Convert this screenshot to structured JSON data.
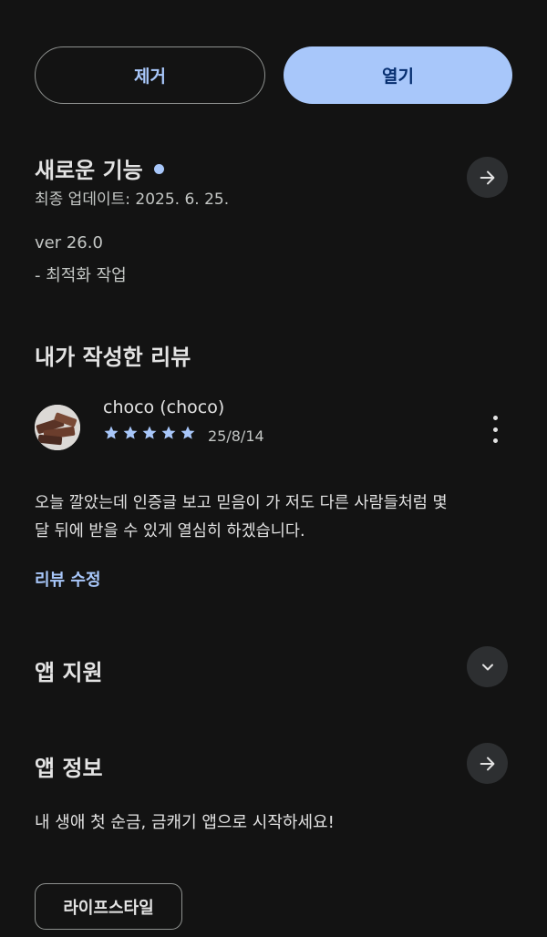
{
  "actions": {
    "uninstall_label": "제거",
    "open_label": "열기"
  },
  "whats_new": {
    "title": "새로운 기능",
    "updated": "최종 업데이트: 2025. 6. 25.",
    "version": "ver 26.0",
    "note": "- 최적화 작업"
  },
  "my_review": {
    "title": "내가 작성한 리뷰",
    "author": "choco (choco)",
    "rating": 5,
    "date": "25/8/14",
    "body_line1": "오늘 깔았는데 인증글 보고 믿음이 가 저도 다른 사람들처럼 몇",
    "body_line2": "달 뒤에 받을 수 있게 열심히 하겠습니다.",
    "edit_label": "리뷰 수정"
  },
  "app_support": {
    "title": "앱 지원"
  },
  "app_info": {
    "title": "앱 정보",
    "description": "내 생애 첫 순금, 금캐기 앱으로 시작하세요!",
    "category": "라이프스타일"
  },
  "colors": {
    "background": "#131313",
    "accent": "#a8c7fa",
    "on_accent": "#062e6f",
    "icon_button_bg": "#2d2f31"
  },
  "icons": {
    "whats_new_action": "arrow-right-icon",
    "review_menu": "more-vert-icon",
    "app_support_action": "chevron-down-icon",
    "app_info_action": "arrow-right-icon",
    "rating": "star-icon"
  }
}
